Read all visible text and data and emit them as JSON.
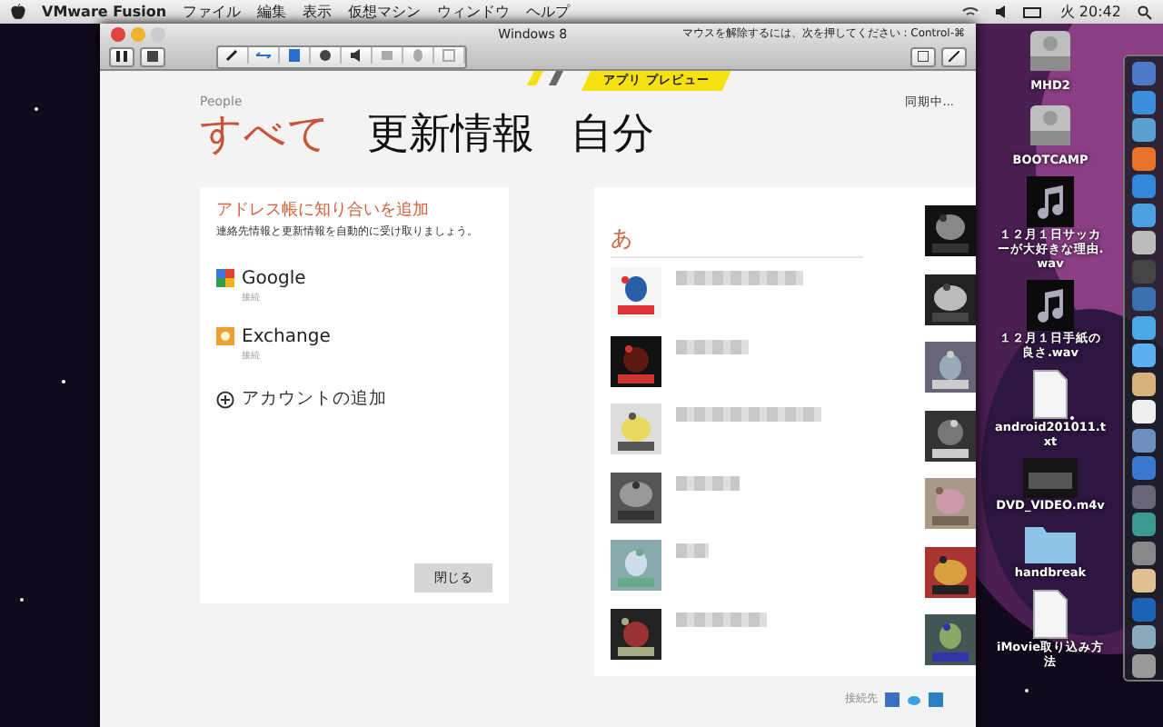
{
  "menubar": {
    "app": "VMware Fusion",
    "menus": [
      "ファイル",
      "編集",
      "表示",
      "仮想マシン",
      "ウィンドウ",
      "ヘルプ"
    ],
    "clock": "火 20:42"
  },
  "vm_window": {
    "title": "Windows 8",
    "hint": "マウスを解除するには、次を押してください : Control-⌘"
  },
  "people_app": {
    "preview_badge": "アプリ プレビュー",
    "section": "People",
    "status": "同期中...",
    "pivots": [
      {
        "label": "すべて",
        "selected": true
      },
      {
        "label": "更新情報",
        "selected": false
      },
      {
        "label": "自分",
        "selected": false
      }
    ],
    "panel": {
      "title": "アドレス帳に知り合いを追加",
      "subtitle": "連絡先情報と更新情報を自動的に受け取りましょう。",
      "accounts": [
        {
          "name": "Google",
          "status": "接続",
          "kind": "google"
        },
        {
          "name": "Exchange",
          "status": "接続",
          "kind": "exchange"
        }
      ],
      "add_account": "アカウントの追加",
      "close_button": "閉じる"
    },
    "contacts": {
      "group_letter": "あ"
    },
    "footer": {
      "label": "接続先"
    }
  },
  "desktop_icons": [
    {
      "label": "MHD2",
      "kind": "drive"
    },
    {
      "label": "BOOTCAMP",
      "kind": "drive"
    },
    {
      "label": "１２月１日サッカーが大好きな理由.wav",
      "kind": "music"
    },
    {
      "label": "１２月１日手紙の良さ.wav",
      "kind": "music"
    },
    {
      "label": "android201011.txt",
      "kind": "text"
    },
    {
      "label": "DVD_VIDEO.m4v",
      "kind": "video"
    },
    {
      "label": "handbreak",
      "kind": "folder"
    },
    {
      "label": "iMovie取り込み方法",
      "kind": "text"
    }
  ]
}
